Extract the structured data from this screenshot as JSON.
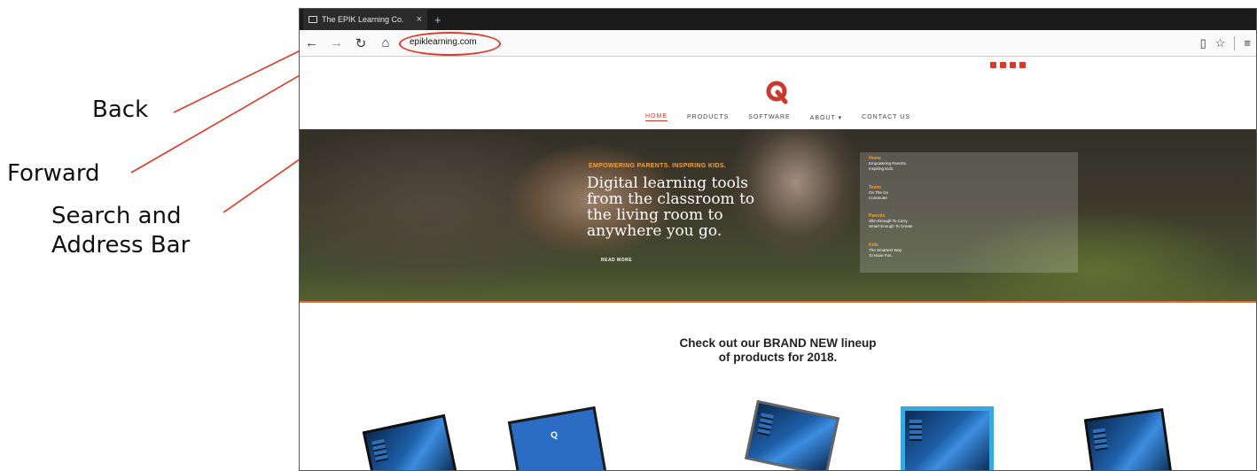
{
  "annotations": {
    "back": "Back",
    "forward": "Forward",
    "search_line1": "Search and",
    "search_line2": "Address Bar",
    "color": "#e03a2a"
  },
  "browser": {
    "tab_title": "The EPIK Learning Co.",
    "tab_close": "×",
    "new_tab": "+",
    "back_icon": "←",
    "forward_icon": "→",
    "refresh_icon": "↻",
    "home_icon": "⌂",
    "address": "epiklearning.com",
    "reading_view_icon": "▯",
    "favorite_icon": "☆",
    "menu_icon": "≡"
  },
  "site": {
    "accent": "#c93a2d",
    "menu": [
      "HOME",
      "PRODUCTS",
      "SOFTWARE",
      "ABOUT ▾",
      "CONTACT US"
    ],
    "hero": {
      "kicker": "EMPOWERING PARENTS. INSPIRING KIDS.",
      "headline_l1": "Digital learning tools",
      "headline_l2": "from the classroom to",
      "headline_l3": "the living room to",
      "headline_l4": "anywhere you go.",
      "read_more": "READ MORE",
      "panel": [
        {
          "title": "Home",
          "desc1": "Empowering Parents.",
          "desc2": "Inspiring Kids."
        },
        {
          "title": "Teens",
          "desc1": "On The Go",
          "desc2": "Commuter"
        },
        {
          "title": "Parents",
          "desc1": "Slim Enough To Carry.",
          "desc2": "Smart Enough To Create"
        },
        {
          "title": "Kids",
          "desc1": "The Smartest Way",
          "desc2": "To Have Fun."
        }
      ]
    },
    "promo_l1": "Check out our BRAND NEW lineup",
    "promo_l2": "of products for 2018.",
    "arrow_left": "‹",
    "arrow_right": "›"
  }
}
